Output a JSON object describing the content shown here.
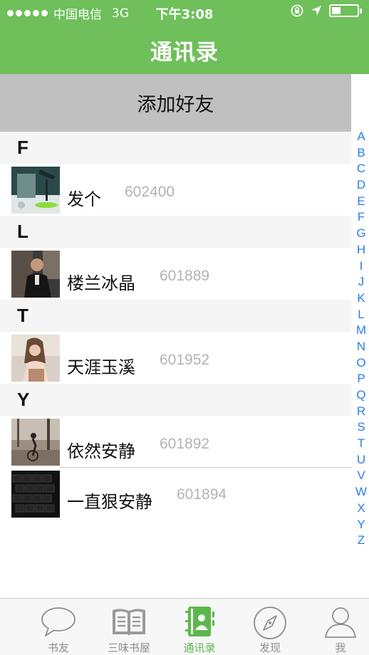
{
  "status_bar": {
    "carrier": "中国电信",
    "network": "3G",
    "time": "下午3:08"
  },
  "header": {
    "title": "通讯录"
  },
  "add_friend": {
    "label": "添加好友"
  },
  "sections": [
    {
      "letter": "F",
      "contacts": [
        {
          "name": "发个",
          "id": "602400",
          "avatar": "avatar-lamp"
        }
      ]
    },
    {
      "letter": "L",
      "contacts": [
        {
          "name": "楼兰冰晶",
          "id": "601889",
          "avatar": "avatar-man"
        }
      ]
    },
    {
      "letter": "T",
      "contacts": [
        {
          "name": "天涯玉溪",
          "id": "601952",
          "avatar": "avatar-girl"
        }
      ]
    },
    {
      "letter": "Y",
      "contacts": [
        {
          "name": "依然安静",
          "id": "601892",
          "avatar": "avatar-cyclist"
        },
        {
          "name": "一直狠安静",
          "id": "601894",
          "avatar": "avatar-keyboard"
        }
      ]
    }
  ],
  "index_letters": [
    "A",
    "B",
    "C",
    "D",
    "E",
    "F",
    "G",
    "H",
    "I",
    "J",
    "K",
    "L",
    "M",
    "N",
    "O",
    "P",
    "Q",
    "R",
    "S",
    "T",
    "U",
    "V",
    "W",
    "X",
    "Y",
    "Z"
  ],
  "tabbar": [
    {
      "label": "书友",
      "icon": "chat-bubble-icon",
      "active": false
    },
    {
      "label": "三味书屋",
      "icon": "book-icon",
      "active": false
    },
    {
      "label": "通讯录",
      "icon": "contacts-book-icon",
      "active": true
    },
    {
      "label": "发现",
      "icon": "compass-icon",
      "active": false
    },
    {
      "label": "我",
      "icon": "person-icon",
      "active": false
    }
  ],
  "colors": {
    "nav_green": "#6fbf5b",
    "tab_active": "#5cb84a",
    "index_blue": "#2b7de9",
    "add_friend_bg": "#c0c0c0"
  }
}
